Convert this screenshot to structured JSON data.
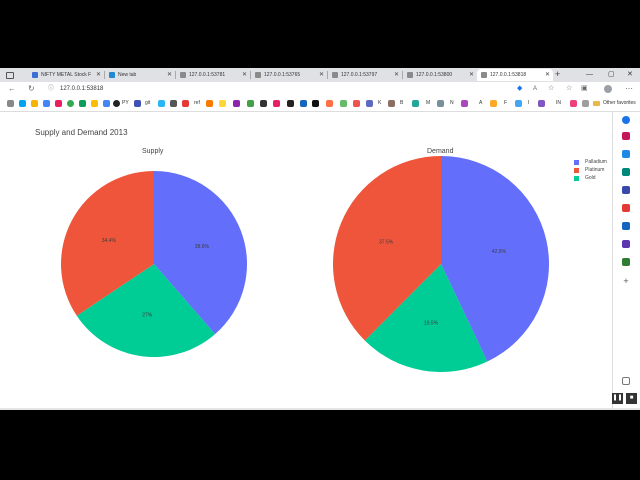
{
  "browser": {
    "tabs": [
      {
        "title": "NIFTY METAL Stock F",
        "icon": "page-icon"
      },
      {
        "title": "New tab",
        "icon": "edge-icon"
      },
      {
        "title": "127.0.0.1:53781",
        "icon": "page-icon"
      },
      {
        "title": "127.0.0.1:53765",
        "icon": "page-icon"
      },
      {
        "title": "127.0.0.1:53797",
        "icon": "page-icon"
      },
      {
        "title": "127.0.0.1:53800",
        "icon": "page-icon"
      },
      {
        "title": "127.0.0.1:53818",
        "icon": "page-icon",
        "active": true
      }
    ],
    "url": "127.0.0.1:53818",
    "bookmarks": [
      "PY",
      "git",
      "ref",
      "K",
      "B",
      "M",
      "N",
      "A",
      "F",
      "I",
      "IN"
    ],
    "other_favorites": "Other favorites"
  },
  "chart_data": {
    "type": "pie",
    "title": "Supply and Demand 2013",
    "legend": {
      "placement": "top-right",
      "entries": [
        "Palladium",
        "Platinum",
        "Gold"
      ]
    },
    "colors": {
      "Palladium": "#636efa",
      "Platinum": "#ef553b",
      "Gold": "#00cc96"
    },
    "pies": [
      {
        "name": "Supply",
        "slices": [
          {
            "label": "Palladium",
            "percent": 38.6,
            "text": "38.6%"
          },
          {
            "label": "Gold",
            "percent": 27,
            "text": "27%"
          },
          {
            "label": "Platinum",
            "percent": 34.4,
            "text": "34.4%"
          }
        ]
      },
      {
        "name": "Demand",
        "slices": [
          {
            "label": "Palladium",
            "percent": 42.9,
            "text": "42.9%"
          },
          {
            "label": "Gold",
            "percent": 19.5,
            "text": "19.5%"
          },
          {
            "label": "Platinum",
            "percent": 37.5,
            "text": "37.5%"
          }
        ]
      }
    ]
  }
}
